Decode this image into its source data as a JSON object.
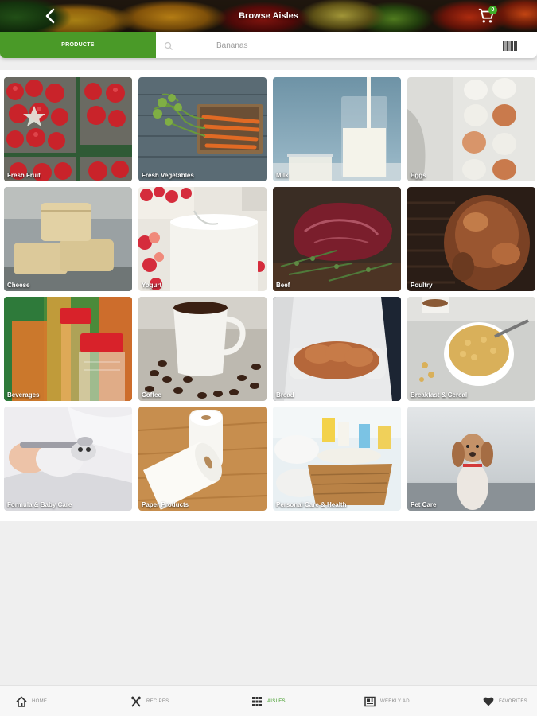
{
  "header": {
    "title": "Browse Aisles",
    "back_icon": "back-arrow-icon",
    "cart_icon": "cart-icon",
    "cart_count": "0"
  },
  "search": {
    "tab_label": "PRODUCTS",
    "placeholder": "Bananas",
    "search_icon": "search-icon",
    "barcode_icon": "barcode-icon"
  },
  "aisles": [
    {
      "label": "Fresh Fruit"
    },
    {
      "label": "Fresh Vegetables"
    },
    {
      "label": "Milk"
    },
    {
      "label": "Eggs"
    },
    {
      "label": "Cheese"
    },
    {
      "label": "Yogurt"
    },
    {
      "label": "Beef"
    },
    {
      "label": "Poultry"
    },
    {
      "label": "Beverages"
    },
    {
      "label": "Coffee"
    },
    {
      "label": "Bread"
    },
    {
      "label": "Breakfast & Cereal"
    },
    {
      "label": "Formula & Baby Care"
    },
    {
      "label": "Paper Products"
    },
    {
      "label": "Personal Care & Health"
    },
    {
      "label": "Pet Care"
    }
  ],
  "nav": {
    "items": [
      {
        "label": "HOME",
        "icon": "home-icon"
      },
      {
        "label": "RECIPES",
        "icon": "utensils-icon"
      },
      {
        "label": "AISLES",
        "icon": "grid-icon"
      },
      {
        "label": "WEEKLY AD",
        "icon": "newspaper-icon"
      },
      {
        "label": "FAVORITES",
        "icon": "heart-icon"
      }
    ],
    "active": "AISLES"
  },
  "colors": {
    "accent_green": "#4a9a28",
    "active_nav": "#3e9a25",
    "badge_green": "#3fae2a"
  }
}
